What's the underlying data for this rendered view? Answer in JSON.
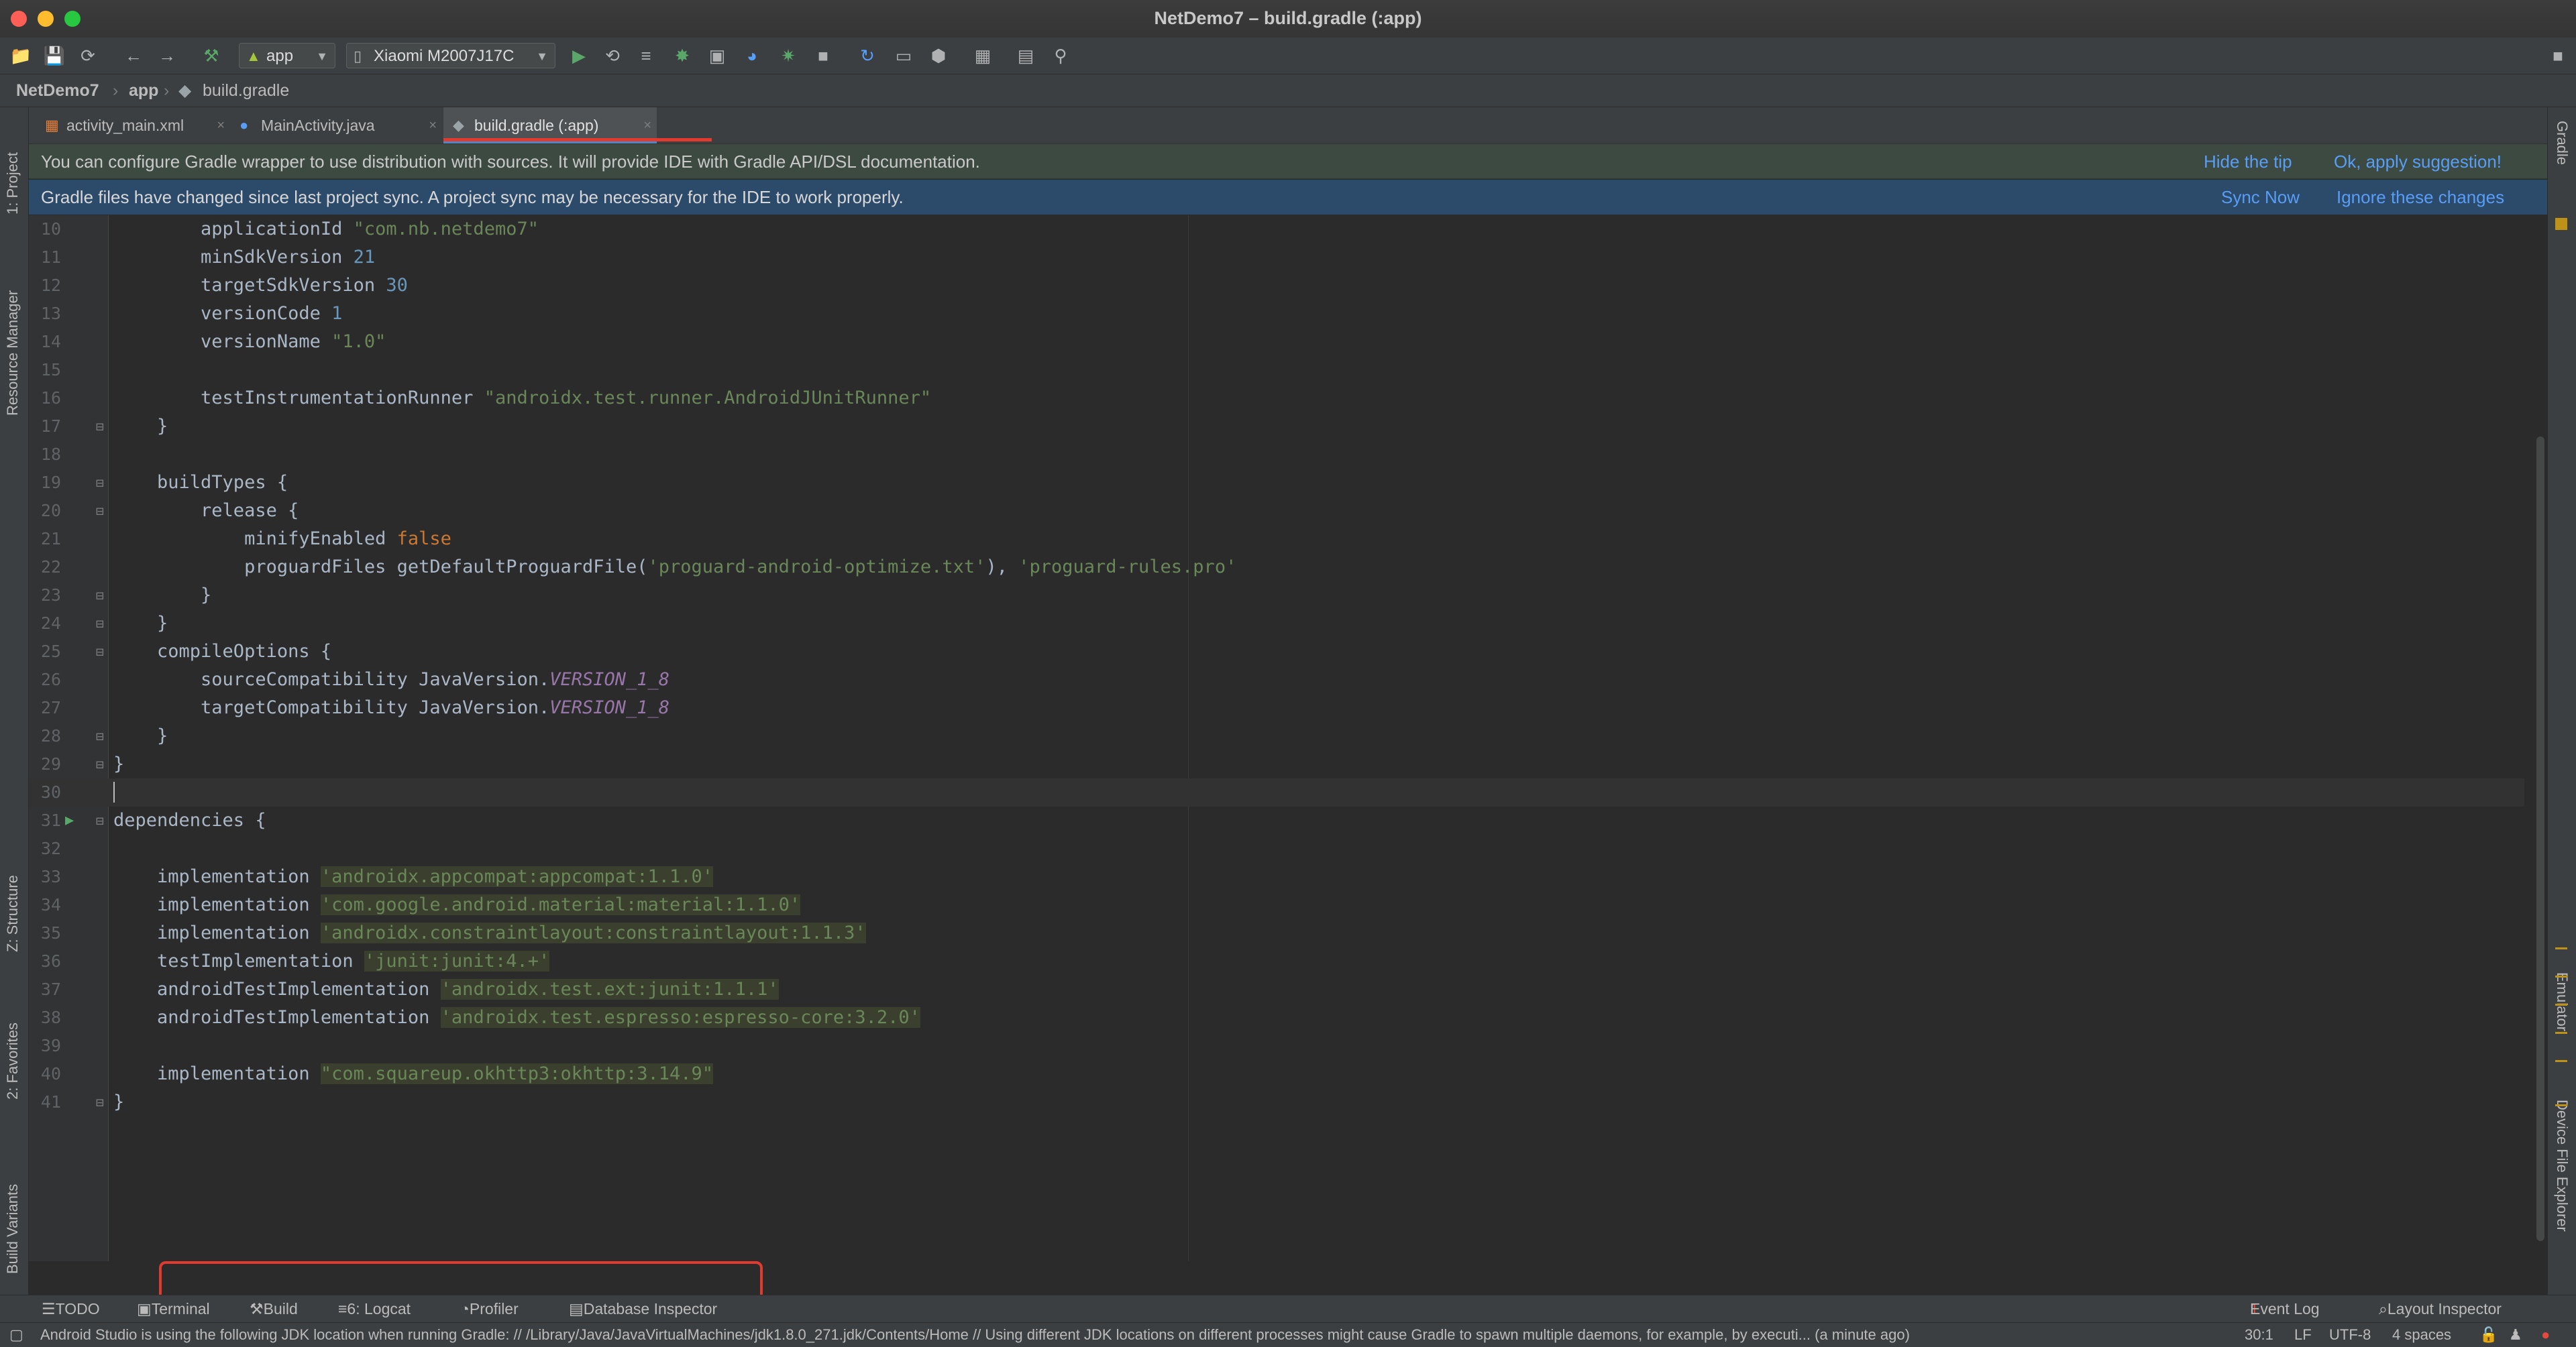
{
  "window": {
    "title": "NetDemo7 – build.gradle (:app)"
  },
  "toolbar": {
    "run_config": "app",
    "device": "Xiaomi M2007J17C"
  },
  "breadcrumb": [
    "NetDemo7",
    "app",
    "build.gradle"
  ],
  "left_tools": [
    "1: Project",
    "Resource Manager",
    "Z: Structure",
    "2: Favorites",
    "Build Variants"
  ],
  "right_tools": [
    "Gradle",
    "Emulator",
    "Device File Explorer"
  ],
  "tabs": [
    {
      "label": "activity_main.xml",
      "active": false
    },
    {
      "label": "MainActivity.java",
      "active": false
    },
    {
      "label": "build.gradle (:app)",
      "active": true
    }
  ],
  "banners": {
    "tip": {
      "text": "You can configure Gradle wrapper to use distribution with sources. It will provide IDE with Gradle API/DSL documentation.",
      "action1": "Hide the tip",
      "action2": "Ok, apply suggestion!"
    },
    "sync": {
      "text": "Gradle files have changed since last project sync. A project sync may be necessary for the IDE to work properly.",
      "action1": "Sync Now",
      "action2": "Ignore these changes"
    }
  },
  "code_lines": [
    {
      "n": "10",
      "t": "        applicationId \"com.nb.netdemo7\""
    },
    {
      "n": "11",
      "t": "        minSdkVersion 21"
    },
    {
      "n": "12",
      "t": "        targetSdkVersion 30"
    },
    {
      "n": "13",
      "t": "        versionCode 1"
    },
    {
      "n": "14",
      "t": "        versionName \"1.0\""
    },
    {
      "n": "15",
      "t": ""
    },
    {
      "n": "16",
      "t": "        testInstrumentationRunner \"androidx.test.runner.AndroidJUnitRunner\""
    },
    {
      "n": "17",
      "t": "    }"
    },
    {
      "n": "18",
      "t": ""
    },
    {
      "n": "19",
      "t": "    buildTypes {"
    },
    {
      "n": "20",
      "t": "        release {"
    },
    {
      "n": "21",
      "t": "            minifyEnabled false"
    },
    {
      "n": "22",
      "t": "            proguardFiles getDefaultProguardFile('proguard-android-optimize.txt'), 'proguard-rules.pro'"
    },
    {
      "n": "23",
      "t": "        }"
    },
    {
      "n": "24",
      "t": "    }"
    },
    {
      "n": "25",
      "t": "    compileOptions {"
    },
    {
      "n": "26",
      "t": "        sourceCompatibility JavaVersion.VERSION_1_8"
    },
    {
      "n": "27",
      "t": "        targetCompatibility JavaVersion.VERSION_1_8"
    },
    {
      "n": "28",
      "t": "    }"
    },
    {
      "n": "29",
      "t": "}"
    },
    {
      "n": "30",
      "t": ""
    },
    {
      "n": "31",
      "t": "dependencies {"
    },
    {
      "n": "32",
      "t": ""
    },
    {
      "n": "33",
      "t": "    implementation 'androidx.appcompat:appcompat:1.1.0'"
    },
    {
      "n": "34",
      "t": "    implementation 'com.google.android.material:material:1.1.0'"
    },
    {
      "n": "35",
      "t": "    implementation 'androidx.constraintlayout:constraintlayout:1.1.3'"
    },
    {
      "n": "36",
      "t": "    testImplementation 'junit:junit:4.+'"
    },
    {
      "n": "37",
      "t": "    androidTestImplementation 'androidx.test.ext:junit:1.1.1'"
    },
    {
      "n": "38",
      "t": "    androidTestImplementation 'androidx.test.espresso:espresso-core:3.2.0'"
    },
    {
      "n": "39",
      "t": ""
    },
    {
      "n": "40",
      "t": "    implementation \"com.squareup.okhttp3:okhttp:3.14.9\""
    },
    {
      "n": "41",
      "t": "}"
    }
  ],
  "bottom_tools": [
    "TODO",
    "Terminal",
    "Build",
    "6: Logcat",
    "Profiler",
    "Database Inspector"
  ],
  "bottom_tools_right": [
    "Event Log",
    "Layout Inspector"
  ],
  "event_log_count": "1",
  "status": {
    "message": "Android Studio is using the following JDK location when running Gradle: // /Library/Java/JavaVirtualMachines/jdk1.8.0_271.jdk/Contents/Home // Using different JDK locations on different processes might cause Gradle to spawn multiple daemons, for example, by executi... (a minute ago)",
    "position": "30:1",
    "line_sep": "LF",
    "encoding": "UTF-8",
    "indent": "4 spaces"
  },
  "colors": {
    "accent": "#4a88c7",
    "link": "#589df6",
    "highlight_box": "#e23a2e",
    "string": "#6a8759",
    "number": "#6897bb",
    "keyword": "#cc7832"
  }
}
